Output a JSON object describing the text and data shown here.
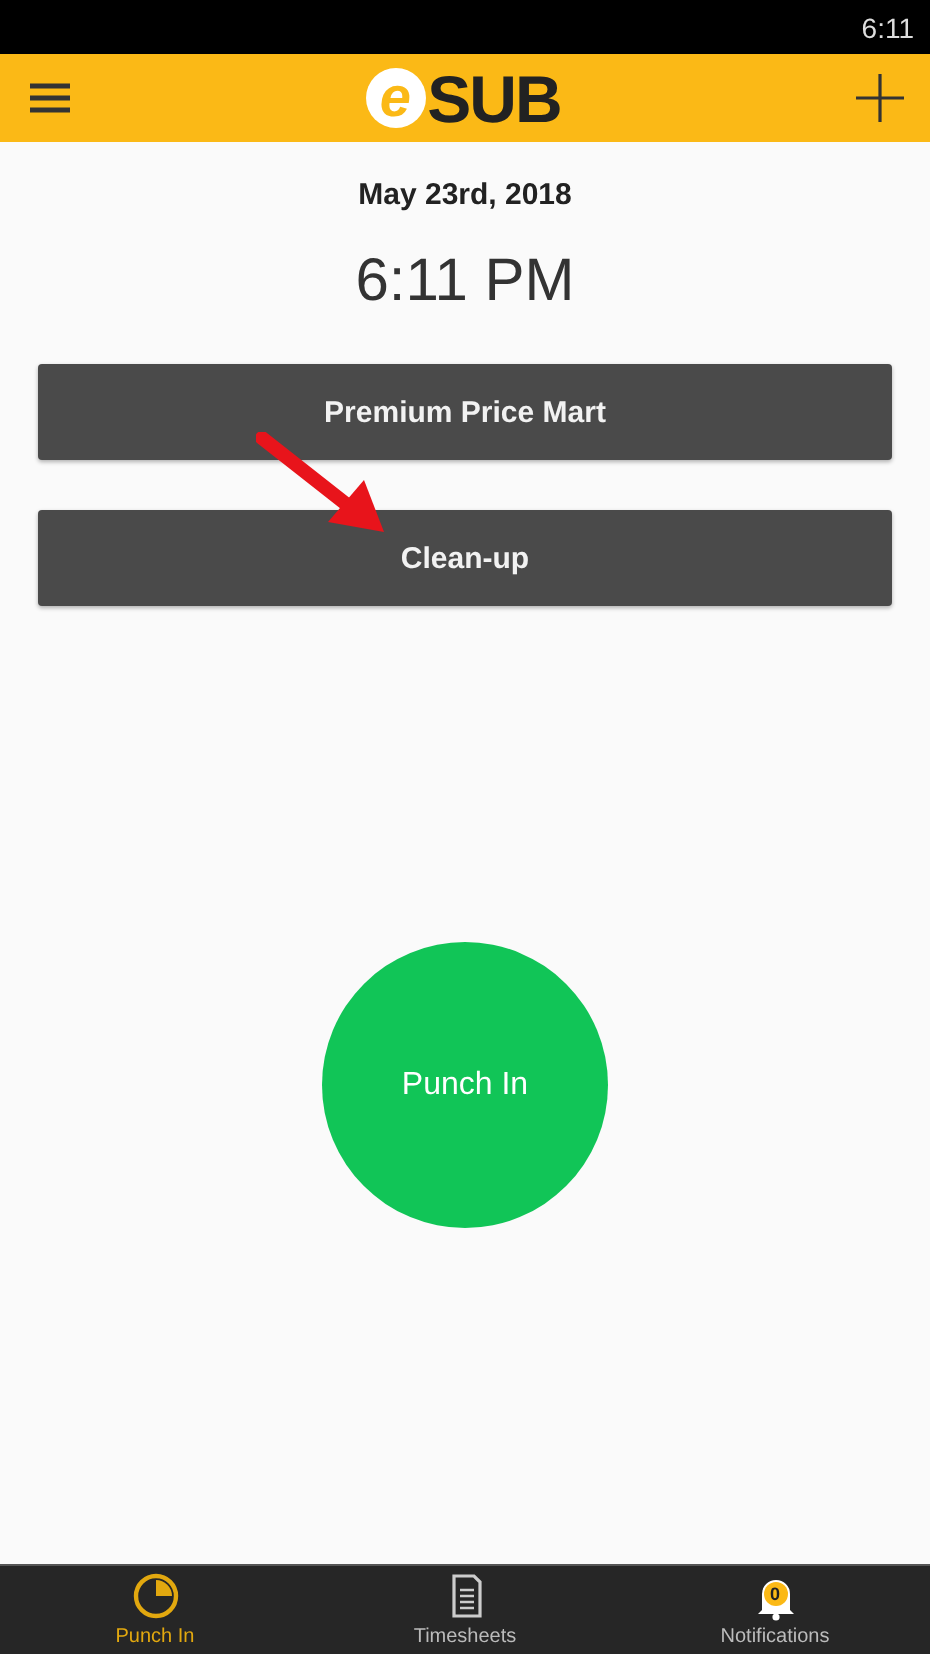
{
  "status_bar": {
    "time": "6:11"
  },
  "header": {
    "logo": {
      "prefix": "e",
      "name": "SUB"
    }
  },
  "date": "May 23rd, 2018",
  "time": "6:11 PM",
  "jobs": [
    {
      "label": "Premium Price Mart"
    },
    {
      "label": "Clean-up"
    }
  ],
  "punch_button": {
    "label": "Punch In"
  },
  "bottom_nav": [
    {
      "kind": "punch",
      "label": "Punch In",
      "selected": true
    },
    {
      "kind": "timesheets",
      "label": "Timesheets",
      "selected": false
    },
    {
      "kind": "notifications",
      "label": "Notifications",
      "selected": false,
      "badge": "0"
    }
  ]
}
